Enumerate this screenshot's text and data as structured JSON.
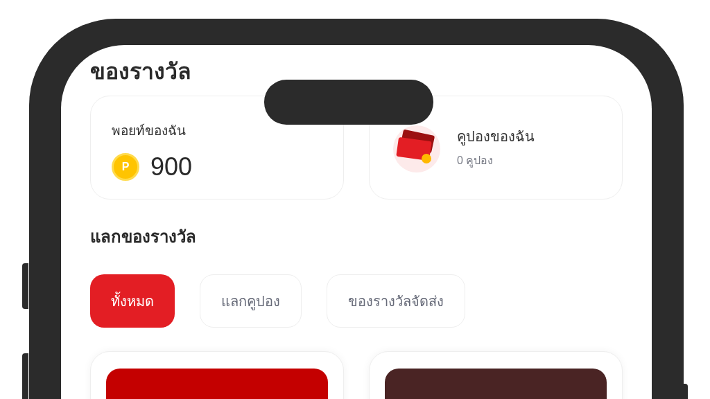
{
  "page_title": "ของรางวัล",
  "points_card": {
    "label": "พอยท์ของฉัน",
    "coin_symbol": "P",
    "value": "900"
  },
  "coupons_card": {
    "label": "คูปองของฉัน",
    "count": "0 คูปอง"
  },
  "section_title": "แลกของรางวัล",
  "tabs": [
    {
      "label": "ทั้งหมด",
      "selected": true
    },
    {
      "label": "แลกคูปอง",
      "selected": false
    },
    {
      "label": "ของรางวัลจัดส่ง",
      "selected": false
    }
  ],
  "reward_cards": [
    {
      "color": "#c40000"
    },
    {
      "color": "#4a2424"
    }
  ]
}
